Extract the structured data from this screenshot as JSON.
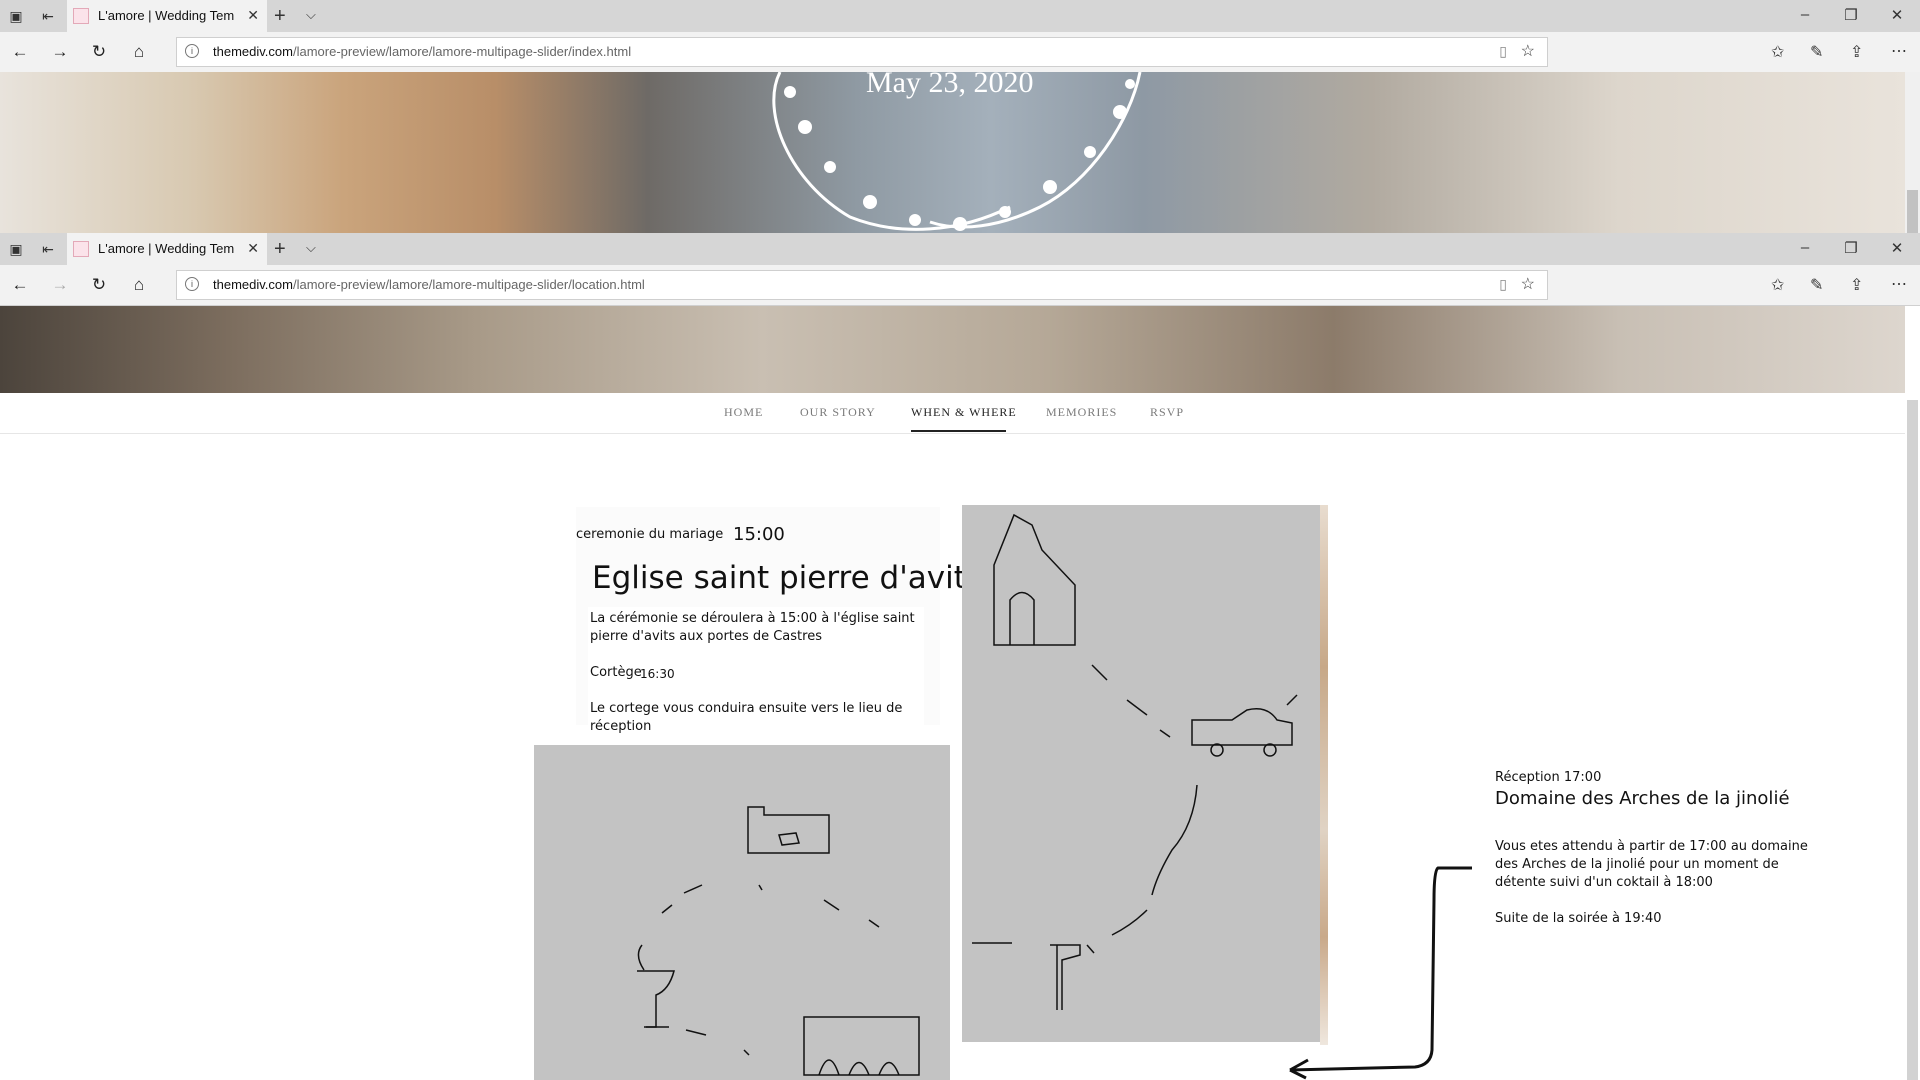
{
  "browser": {
    "tab_title": "L'amore | Wedding Tem",
    "window1_url_domain": "themediv.com",
    "window1_url_path": "/lamore-preview/lamore/lamore-multipage-slider/index.html",
    "window2_url_domain": "themediv.com",
    "window2_url_path": "/lamore-preview/lamore/lamore-multipage-slider/location.html"
  },
  "hero": {
    "date": "May 23, 2020"
  },
  "nav": {
    "items": [
      "HOME",
      "OUR STORY",
      "WHEN & WHERE",
      "MEMORIES",
      "RSVP"
    ],
    "active": "WHEN & WHERE"
  },
  "ceremony": {
    "label": "ceremonie du  mariage",
    "time": "15:00",
    "title": "Eglise saint pierre d'avits",
    "desc_line1": "La cérémonie se déroulera à 15:00 à l'église saint",
    "desc_line2": "pierre d'avits aux portes de Castres",
    "cortege_label": "Cortège",
    "cortege_time": "16:30",
    "cortege_line1": "Le cortege vous conduira ensuite vers le lieu de",
    "cortege_line2": "réception"
  },
  "reception": {
    "label": "Réception 17:00",
    "title": "Domaine des Arches de la jinolié",
    "desc_line1": "Vous etes attendu à partir de 17:00 au domaine",
    "desc_line2": "des Arches de la jinolié pour un moment de",
    "desc_line3": "détente suivi d'un coktail à 18:00",
    "suite": "Suite de la soirée à 19:40"
  },
  "colors": {
    "chrome": "#d6d6d6",
    "sketch_bg": "#c3c3c3",
    "active_nav": "#222222"
  }
}
